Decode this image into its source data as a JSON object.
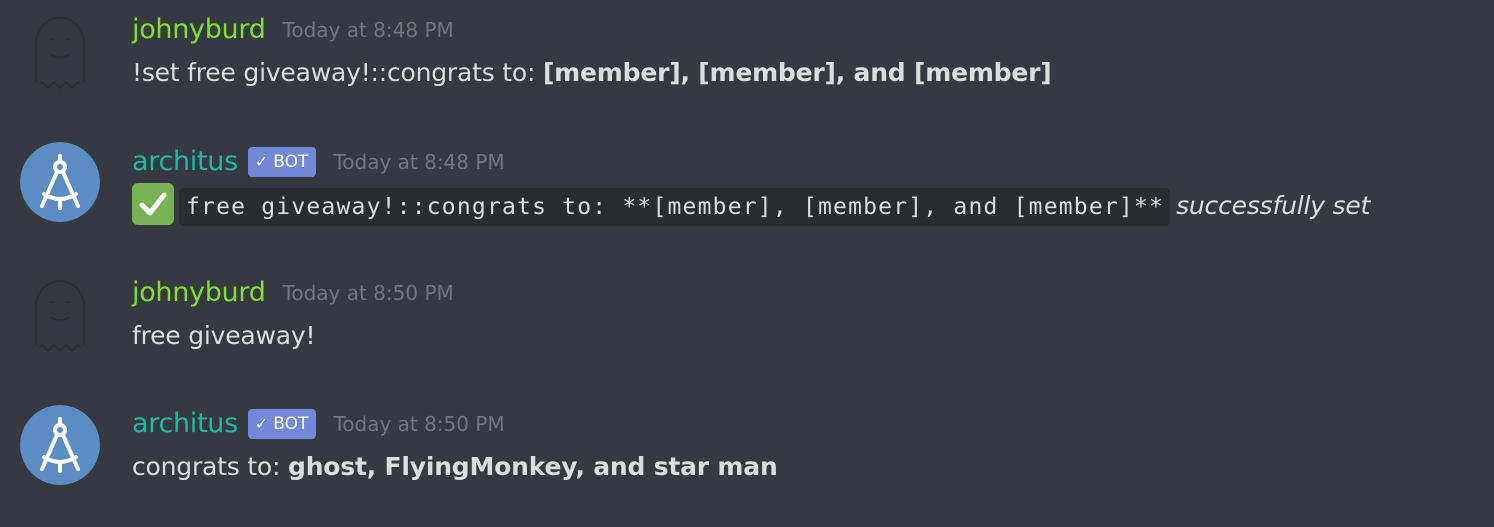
{
  "messages": [
    {
      "author": "johnyburd",
      "avatar": "ghost-icon",
      "timestamp": "Today at 8:48 PM",
      "text_prefix": "!set free giveaway!::congrats to: ",
      "text_bold": "[member], [member], and [member]"
    },
    {
      "author": "architus",
      "avatar": "compass-icon",
      "bot_tag": "BOT",
      "timestamp": "Today at 8:48 PM",
      "emoji": "white-check-mark-icon",
      "code": "free giveaway!::congrats to: **[member], [member], and [member]**",
      "text_suffix": "successfully set"
    },
    {
      "author": "johnyburd",
      "avatar": "ghost-icon",
      "timestamp": "Today at 8:50 PM",
      "text": "free giveaway!"
    },
    {
      "author": "architus",
      "avatar": "compass-icon",
      "bot_tag": "BOT",
      "timestamp": "Today at 8:50 PM",
      "text_prefix": "congrats to: ",
      "text_bold": "ghost, FlyingMonkey, and star man"
    }
  ],
  "colors": {
    "background": "#36393f",
    "user_name": "#7fe02e",
    "bot_name": "#1fb8a3",
    "bot_tag": "#7289da",
    "timestamp": "#72767d",
    "text": "#dcddde",
    "bot_avatar": "#5b8cc4"
  }
}
